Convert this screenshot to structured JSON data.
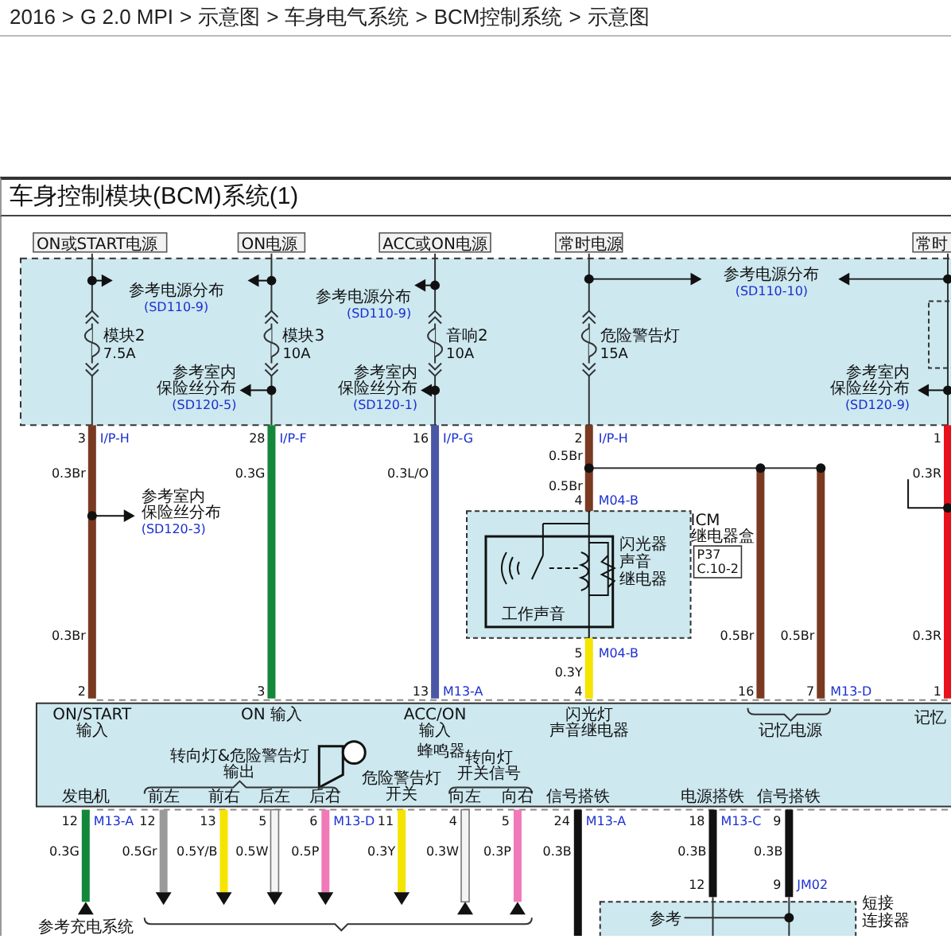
{
  "breadcrumb": {
    "items": [
      "2016",
      "G 2.0 MPI",
      "示意图",
      "车身电气系统",
      "BCM控制系统",
      "示意图"
    ],
    "separator": ">"
  },
  "diagram": {
    "title": "车身控制模块(BCM)系统(1)",
    "power_sources": [
      "ON或START电源",
      "ON电源",
      "ACC或ON电源",
      "常时电源",
      "常时"
    ],
    "fuses": [
      {
        "name": "模块2",
        "rating": "7.5A"
      },
      {
        "name": "模块3",
        "rating": "10A"
      },
      {
        "name": "音响2",
        "rating": "10A"
      },
      {
        "name": "危险警告灯",
        "rating": "15A"
      }
    ],
    "references": [
      {
        "lines": [
          "参考电源分布"
        ],
        "code": "(SD110-9)"
      },
      {
        "lines": [
          "参考电源分布"
        ],
        "code": "(SD110-9)"
      },
      {
        "lines": [
          "参考室内",
          "保险丝分布"
        ],
        "code": "(SD120-5)"
      },
      {
        "lines": [
          "参考室内",
          "保险丝分布"
        ],
        "code": "(SD120-1)"
      },
      {
        "lines": [
          "参考电源分布"
        ],
        "code": "(SD110-10)"
      },
      {
        "lines": [
          "参考室内",
          "保险丝分布"
        ],
        "code": "(SD120-9)"
      },
      {
        "lines": [
          "参考室内",
          "保险丝分布"
        ],
        "code": "(SD120-3)"
      },
      {
        "lines": [
          "参考"
        ]
      },
      {
        "lines": [
          "参考充电系统"
        ]
      }
    ],
    "wires": [
      {
        "color": "#7a3a22"
      },
      {
        "color": "#13873a"
      },
      {
        "color": "#4a56a6"
      },
      {
        "color": "#7a3a22"
      },
      {
        "color": "#f5e400"
      },
      {
        "color": "#7a3a22"
      },
      {
        "color": "#7a3a22"
      },
      {
        "color": "#e8101a"
      },
      {
        "color": "#13873a"
      },
      {
        "color": "#9a9a9a"
      },
      {
        "color": "#f5e400"
      },
      {
        "color": "#f4f4f4"
      },
      {
        "color": "#f07ab8"
      },
      {
        "color": "#f5e400"
      },
      {
        "color": "#f4f4f4"
      },
      {
        "color": "#f07ab8"
      },
      {
        "color": "#111111"
      },
      {
        "color": "#111111"
      },
      {
        "color": "#111111"
      }
    ],
    "pins": [
      "3",
      "28",
      "16",
      "2",
      "1",
      "4",
      "5",
      "2",
      "3",
      "13",
      "4",
      "16",
      "7",
      "1",
      "12",
      "12",
      "13",
      "5",
      "6",
      "11",
      "4",
      "5",
      "24",
      "18",
      "9",
      "12",
      "9"
    ],
    "connectors": [
      "I/P-H",
      "I/P-F",
      "I/P-G",
      "I/P-H",
      "M04-B",
      "M04-B",
      "M13-A",
      "M13-D",
      "M13-A",
      "M13-D",
      "M13-A",
      "M13-C",
      "JM02"
    ],
    "wire_specs": [
      "0.5Br",
      "0.3Br",
      "0.3G",
      "0.3L/O",
      "0.3R",
      "0.5Br",
      "0.3Br",
      "0.5Br",
      "0.5Br",
      "0.3R",
      "0.3Y",
      "0.3G",
      "0.5Gr",
      "0.5Y/B",
      "0.5W",
      "0.5P",
      "0.3Y",
      "0.3W",
      "0.3P",
      "0.3B",
      "0.3B",
      "0.3B"
    ],
    "relay_box": {
      "name": [
        "ICM",
        "继电器盒"
      ],
      "location": [
        "P37",
        "C.10-2"
      ],
      "relay": [
        "闪光器",
        "声音",
        "继电器"
      ],
      "sound": "工作声音"
    },
    "bcm_labels": [
      [
        "ON/START",
        "输入"
      ],
      [
        "ON 输入"
      ],
      [
        "ACC/ON",
        "输入"
      ],
      [
        "闪光灯",
        "声音继电器"
      ],
      [
        "记忆电源"
      ],
      [
        "记忆"
      ],
      [
        "转向灯&危险警告灯",
        "输出"
      ],
      [
        "蜂鸣器"
      ],
      [
        "危险警告灯",
        "开关"
      ],
      [
        "转向灯",
        "开关信号"
      ],
      [
        "发电机"
      ],
      [
        "前左"
      ],
      [
        "前右"
      ],
      [
        "后左"
      ],
      [
        "后右"
      ],
      [
        "向左"
      ],
      [
        "向右"
      ],
      [
        "信号搭铁"
      ],
      [
        "电源搭铁"
      ],
      [
        "信号搭铁"
      ]
    ],
    "joint_connector": [
      "短接",
      "连接器"
    ]
  }
}
